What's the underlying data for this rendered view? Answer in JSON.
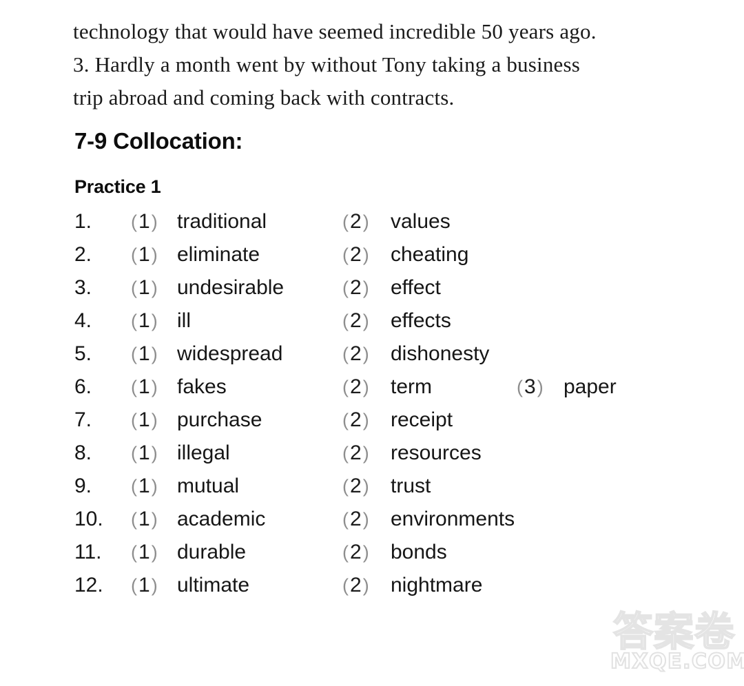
{
  "page": {
    "background_color": "#ffffff",
    "text_color": "#161616"
  },
  "passage": {
    "lines": [
      "technology that would have seemed incredible 50 years ago.",
      "3. Hardly a month went by without Tony taking a business",
      "trip abroad and coming back with contracts."
    ]
  },
  "headings": {
    "section": "7-9 Collocation:",
    "practice": "Practice 1"
  },
  "answers": {
    "rows": [
      {
        "num": "1.",
        "s1": "1",
        "w1": "traditional",
        "s2": "2",
        "w2": "values",
        "s3": "",
        "w3": ""
      },
      {
        "num": "2.",
        "s1": "1",
        "w1": "eliminate",
        "s2": "2",
        "w2": "cheating",
        "s3": "",
        "w3": ""
      },
      {
        "num": "3.",
        "s1": "1",
        "w1": "undesirable",
        "s2": "2",
        "w2": "effect",
        "s3": "",
        "w3": ""
      },
      {
        "num": "4.",
        "s1": "1",
        "w1": "ill",
        "s2": "2",
        "w2": "effects",
        "s3": "",
        "w3": ""
      },
      {
        "num": "5.",
        "s1": "1",
        "w1": "widespread",
        "s2": "2",
        "w2": "dishonesty",
        "s3": "",
        "w3": ""
      },
      {
        "num": "6.",
        "s1": "1",
        "w1": "fakes",
        "s2": "2",
        "w2": "term",
        "s3": "3",
        "w3": "paper"
      },
      {
        "num": "7.",
        "s1": "1",
        "w1": "purchase",
        "s2": "2",
        "w2": "receipt",
        "s3": "",
        "w3": ""
      },
      {
        "num": "8.",
        "s1": "1",
        "w1": "illegal",
        "s2": "2",
        "w2": "resources",
        "s3": "",
        "w3": ""
      },
      {
        "num": "9.",
        "s1": "1",
        "w1": "mutual",
        "s2": "2",
        "w2": "trust",
        "s3": "",
        "w3": ""
      },
      {
        "num": "10.",
        "s1": "1",
        "w1": "academic",
        "s2": "2",
        "w2": "environments",
        "s3": "",
        "w3": ""
      },
      {
        "num": "11.",
        "s1": "1",
        "w1": "durable",
        "s2": "2",
        "w2": "bonds",
        "s3": "",
        "w3": ""
      },
      {
        "num": "12.",
        "s1": "1",
        "w1": "ultimate",
        "s2": "2",
        "w2": "nightmare",
        "s3": "",
        "w3": ""
      }
    ]
  },
  "watermark": {
    "chinese": "答案卷",
    "url": "MXQE.COM",
    "color": "#e4e4e4"
  }
}
